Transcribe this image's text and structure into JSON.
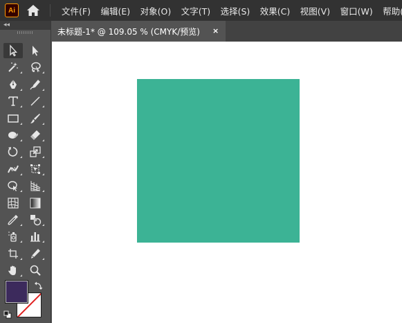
{
  "app": {
    "logo_text": "Ai",
    "home_icon": "home-icon"
  },
  "menu": {
    "items": [
      "文件(F)",
      "编辑(E)",
      "对象(O)",
      "文字(T)",
      "选择(S)",
      "效果(C)",
      "视图(V)",
      "窗口(W)",
      "帮助(H)"
    ]
  },
  "document_tab": {
    "title": "未标题-1* @ 109.05 % (CMYK/预览)",
    "close_label": "×"
  },
  "toolbar": {
    "collapse_label": "◂◂",
    "tools": [
      {
        "name": "selection-tool",
        "icon": "arrow-icon",
        "active": true
      },
      {
        "name": "direct-selection-tool",
        "icon": "direct-arrow-icon"
      },
      {
        "name": "magic-wand-tool",
        "icon": "magic-wand-icon"
      },
      {
        "name": "lasso-tool",
        "icon": "lasso-icon"
      },
      {
        "name": "pen-tool",
        "icon": "pen-icon"
      },
      {
        "name": "curvature-tool",
        "icon": "curvature-pen-icon"
      },
      {
        "name": "type-tool",
        "icon": "type-icon"
      },
      {
        "name": "line-tool",
        "icon": "line-icon"
      },
      {
        "name": "rectangle-tool",
        "icon": "rectangle-icon"
      },
      {
        "name": "paintbrush-tool",
        "icon": "brush-icon"
      },
      {
        "name": "shaper-tool",
        "icon": "shaper-icon"
      },
      {
        "name": "eraser-tool",
        "icon": "eraser-icon"
      },
      {
        "name": "rotate-tool",
        "icon": "rotate-icon"
      },
      {
        "name": "scale-tool",
        "icon": "scale-icon"
      },
      {
        "name": "width-tool",
        "icon": "width-icon"
      },
      {
        "name": "free-transform-tool",
        "icon": "free-transform-icon"
      },
      {
        "name": "shape-builder-tool",
        "icon": "shape-builder-icon"
      },
      {
        "name": "perspective-grid-tool",
        "icon": "perspective-grid-icon"
      },
      {
        "name": "mesh-tool",
        "icon": "mesh-icon"
      },
      {
        "name": "gradient-tool",
        "icon": "gradient-icon"
      },
      {
        "name": "eyedropper-tool",
        "icon": "eyedropper-icon"
      },
      {
        "name": "blend-tool",
        "icon": "blend-icon"
      },
      {
        "name": "symbol-sprayer-tool",
        "icon": "symbol-sprayer-icon"
      },
      {
        "name": "column-graph-tool",
        "icon": "graph-icon"
      },
      {
        "name": "artboard-tool",
        "icon": "artboard-icon"
      },
      {
        "name": "slice-tool",
        "icon": "slice-icon"
      },
      {
        "name": "hand-tool",
        "icon": "hand-icon"
      },
      {
        "name": "zoom-tool",
        "icon": "zoom-icon"
      }
    ]
  },
  "colors": {
    "fill": "#3c2a5c",
    "stroke": "none",
    "shape_fill": "#3cb395",
    "menubar_bg": "#323232",
    "panel_bg": "#535353"
  },
  "canvas": {
    "shape": "rectangle"
  }
}
